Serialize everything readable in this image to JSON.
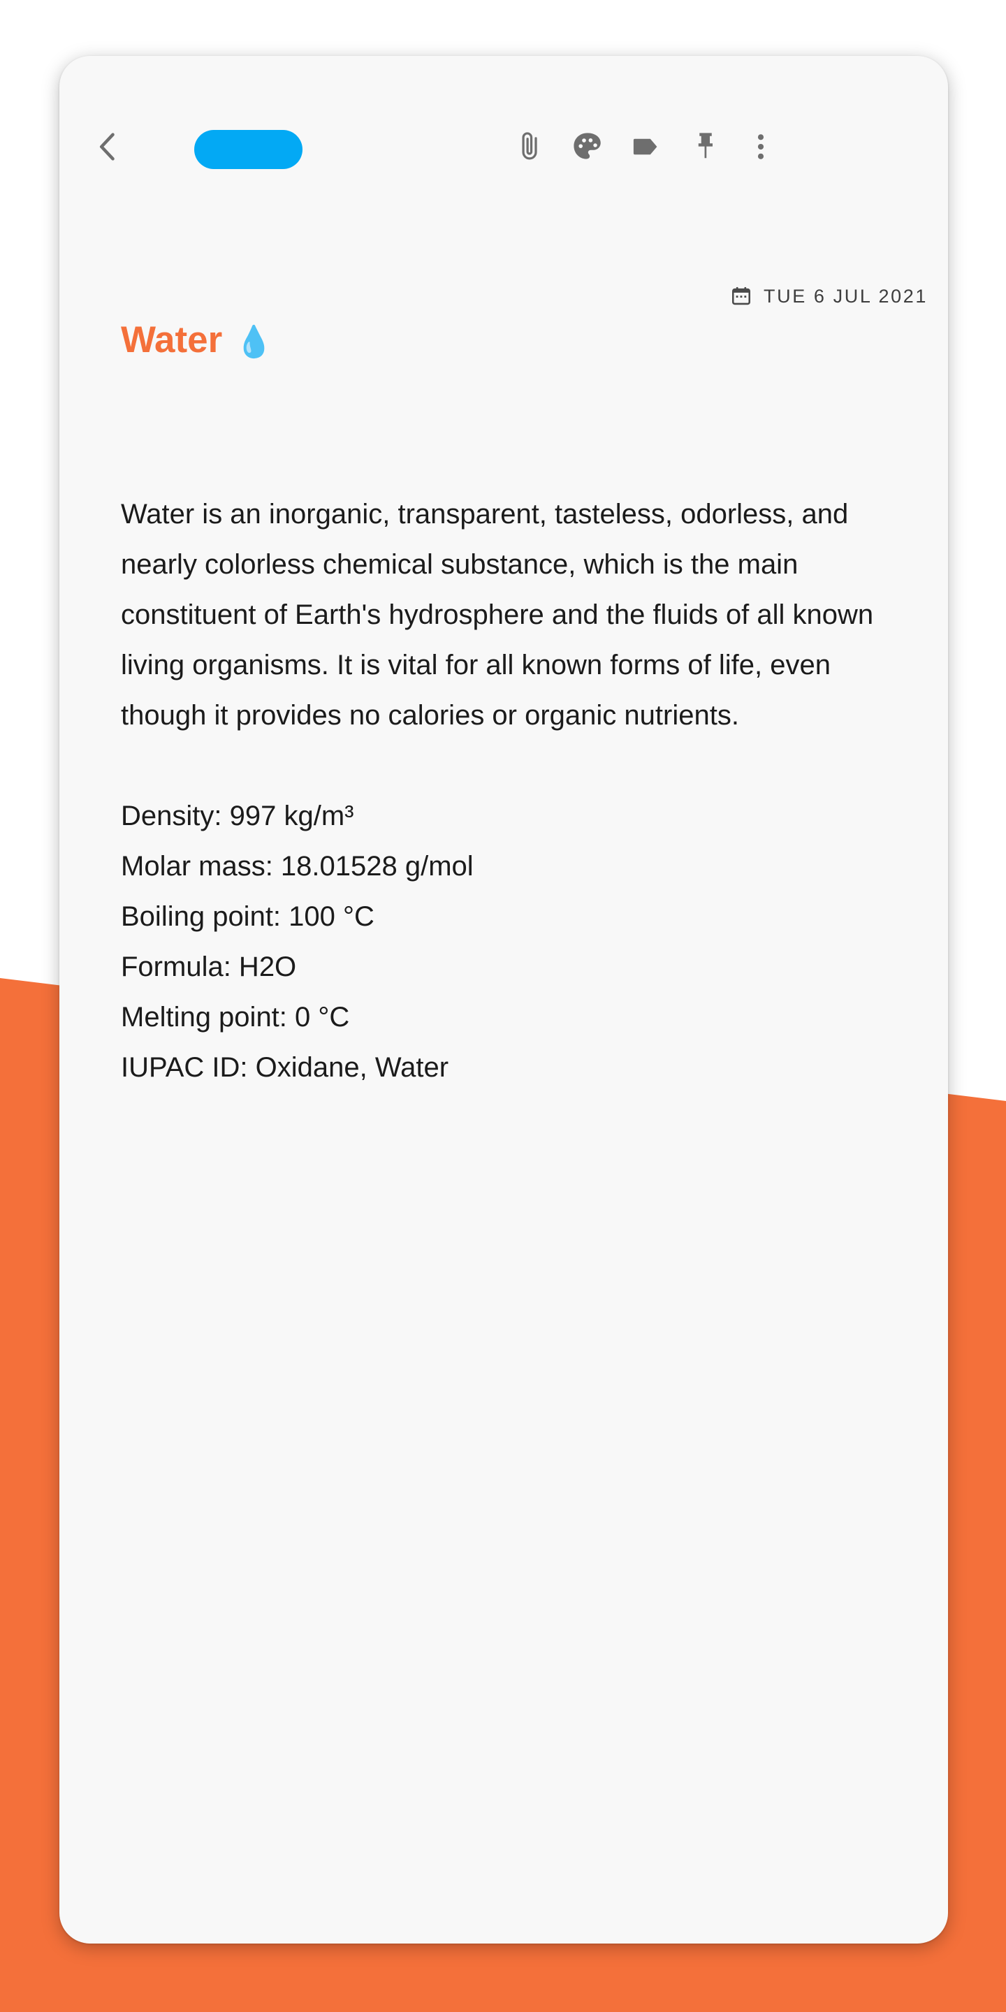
{
  "theme": {
    "background_white": "#ffffff",
    "background_orange": "#f4703a",
    "card_background": "#f8f8f8",
    "accent_orange": "#f4703a",
    "note_color_pill": "#03a9f4",
    "icon_gray": "#6e6e6e",
    "text_primary": "#1b1b1b",
    "text_date": "#3d3d3d"
  },
  "toolbar": {
    "back_label": "Back",
    "back_icon": "chevron-left-icon",
    "color_pill_label": "Note color",
    "color_pill_value": "#03a9f4",
    "actions": [
      {
        "name": "attach-button",
        "icon": "paperclip-icon",
        "label": "Attach"
      },
      {
        "name": "palette-button",
        "icon": "palette-icon",
        "label": "Color"
      },
      {
        "name": "tag-button",
        "icon": "tag-icon",
        "label": "Tag"
      },
      {
        "name": "pin-button",
        "icon": "pin-icon",
        "label": "Pin"
      },
      {
        "name": "overflow-button",
        "icon": "more-vertical-icon",
        "label": "More options"
      }
    ]
  },
  "note": {
    "date_icon": "calendar-icon",
    "date": "TUE 6 JUL 2021",
    "title": "Water",
    "title_emoji": "💧",
    "paragraph": "Water is an inorganic, transparent, tasteless, odorless, and nearly colorless chemical substance, which is the main constituent of Earth's hydrosphere and the fluids of all known living organisms. It is vital for all known forms of life, even though it provides no calories or organic nutrients.",
    "properties": [
      "Density: 997 kg/m³",
      "Molar mass: 18.01528 g/mol",
      "Boiling point: 100 °C",
      "Formula: H2O",
      "Melting point: 0 °C",
      "IUPAC ID: Oxidane, Water"
    ]
  }
}
